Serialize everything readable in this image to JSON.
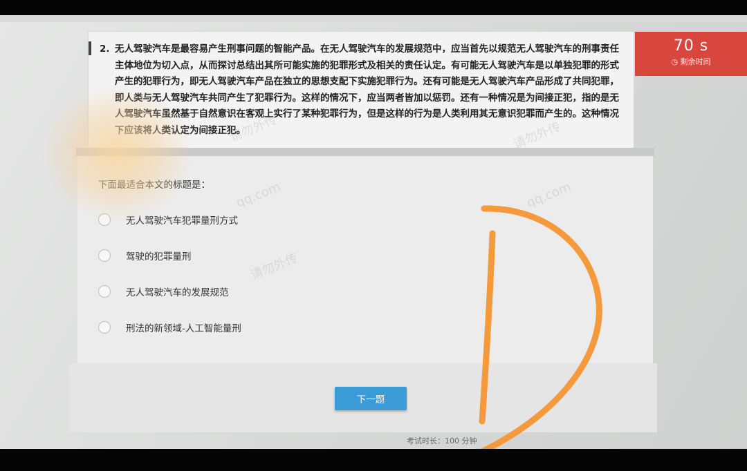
{
  "question": {
    "number": "2.",
    "text": "无人驾驶汽车是最容易产生刑事问题的智能产品。在无人驾驶汽车的发展规范中，应当首先以规范无人驾驶汽车的刑事责任主体地位为切入点，从而探讨总结出其所可能实施的犯罪形式及相关的责任认定。有可能无人驾驶汽车是以单独犯罪的形式产生的犯罪行为，即无人驾驶汽车产品在独立的思想支配下实施犯罪行为。还有可能是无人驾驶汽车产品形成了共同犯罪，即人类与无人驾驶汽车共同产生了犯罪行为。这样的情况下，应当两者皆加以惩罚。还有一种情况是为间接正犯，指的是无人驾驶汽车虽然基于自然意识在客观上实行了某种犯罪行为，但是这样的行为是人类利用其无意识犯罪而产生的。这种情况下应该将人类认定为间接正犯。"
  },
  "prompt": "下面最适合本文的标题是：",
  "options": [
    {
      "label": "无人驾驶汽车犯罪量刑方式"
    },
    {
      "label": "驾驶的犯罪量刑"
    },
    {
      "label": "无人驾驶汽车的发展规范"
    },
    {
      "label": "刑法的新领域-人工智能量刑"
    }
  ],
  "next_button": "下一题",
  "timer": {
    "value": "70 s",
    "label": "剩余时间"
  },
  "footer": "考试时长：100 分钟",
  "watermarks": [
    "请勿外传",
    "qq.com",
    "请勿外传",
    "请勿外传",
    "qq.com"
  ],
  "annotation": {
    "letter": "D",
    "color": "#f59a3c"
  }
}
